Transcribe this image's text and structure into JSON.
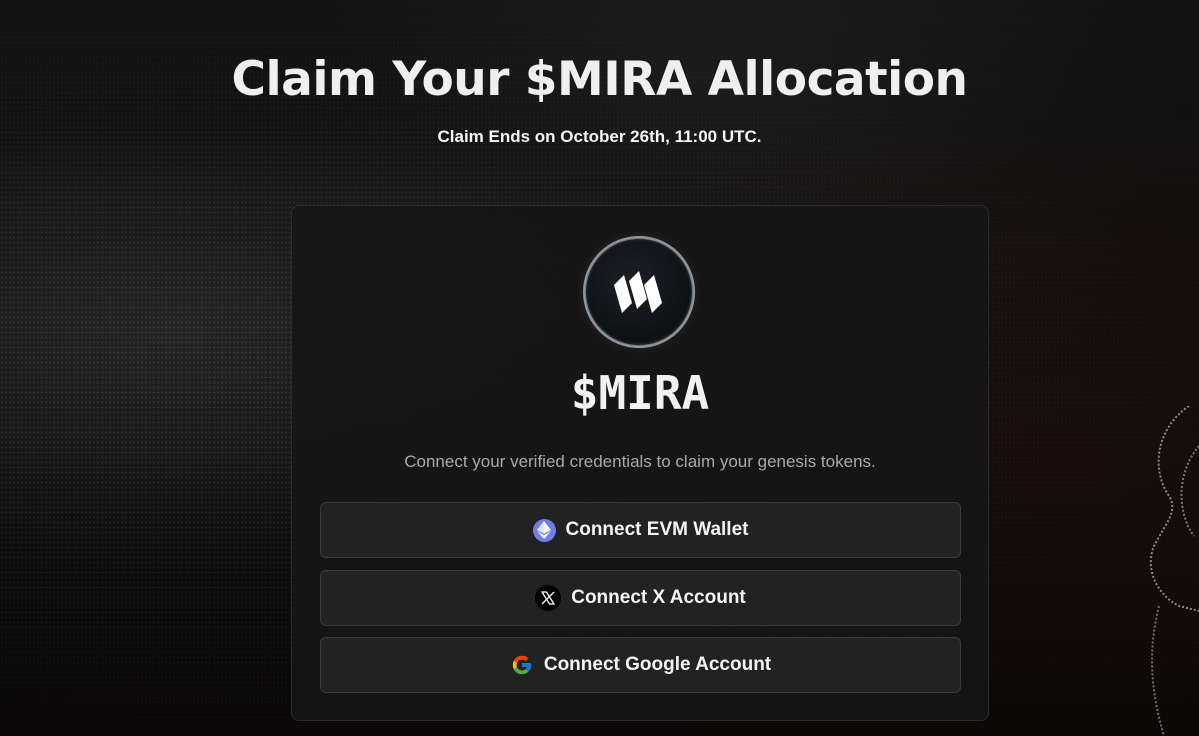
{
  "header": {
    "title": "Claim Your $MIRA Allocation",
    "subtitle": "Claim Ends on October 26th, 11:00 UTC."
  },
  "card": {
    "token_name": "$MIRA",
    "description": "Connect your verified credentials to claim your genesis tokens.",
    "buttons": [
      {
        "label": "Connect EVM Wallet",
        "icon": "ethereum-icon"
      },
      {
        "label": "Connect X Account",
        "icon": "x-logo-icon"
      },
      {
        "label": "Connect Google Account",
        "icon": "google-icon"
      }
    ]
  },
  "colors": {
    "background": "#0b0b0b",
    "card_bg": "#161616",
    "button_bg": "#222222",
    "button_border": "#3a3a3a",
    "ethereum_blue": "#6f7fe8"
  }
}
